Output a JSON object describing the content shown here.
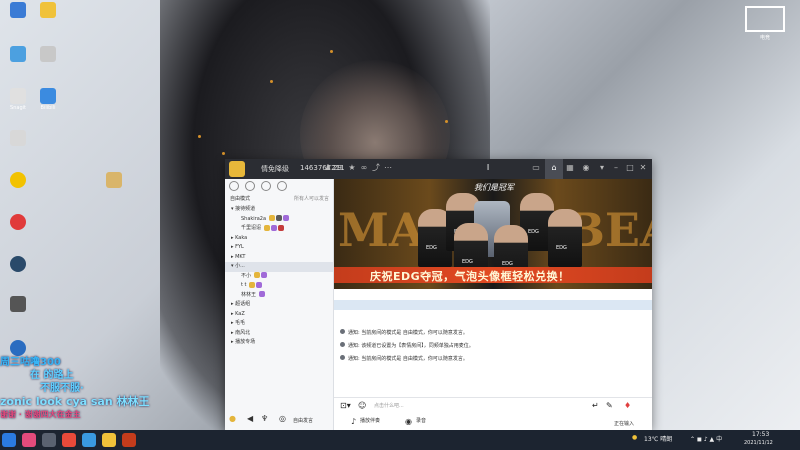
{
  "desktop": {
    "icons": [
      "Snagit",
      "Snagit",
      "Bilibili",
      "",
      "",
      "",
      "",
      "",
      "",
      "",
      "",
      "",
      ""
    ],
    "stream_overlay_lines": [
      {
        "text": "周三咕噜300",
        "color": "#38b4f5"
      },
      {
        "text": "在 的路上",
        "color": "#5fd0ff"
      },
      {
        "text": "不服不服·",
        "color": "#5fd0ff"
      },
      {
        "text": "zonic look cya san 林林王",
        "color": "#7fe0ff"
      },
      {
        "text": "谢谢 · 谢谢四大在金主",
        "color": "#e34b7c"
      }
    ],
    "watermark": "电竞"
  },
  "app": {
    "title": {
      "channel_name": "情免降级",
      "channel_id": "1463767211",
      "online_count": "29"
    },
    "top_icons": [
      "home-icon",
      "grid-icon",
      "gamepad-icon",
      "shirt-icon",
      "minimize-icon",
      "maximize-icon",
      "close-icon"
    ],
    "left_panel": {
      "mode_label": "自由模式",
      "mode_right": "所有人可以发言",
      "channels": [
        {
          "name": "接待频道",
          "type": "group",
          "expanded": true
        },
        {
          "name": "Shakira2a",
          "type": "user"
        },
        {
          "name": "千里迢迢",
          "type": "user"
        },
        {
          "name": "Kaka",
          "type": "group"
        },
        {
          "name": "FYL",
          "type": "group"
        },
        {
          "name": "MKT",
          "type": "group"
        },
        {
          "name": "小...",
          "type": "group",
          "active": true
        },
        {
          "name": "不小",
          "type": "user"
        },
        {
          "name": "t t",
          "type": "user"
        },
        {
          "name": "林林王",
          "type": "user"
        },
        {
          "name": "超话组",
          "type": "group"
        },
        {
          "name": "KaZ",
          "type": "group"
        },
        {
          "name": "毛毛",
          "type": "group"
        },
        {
          "name": "南风北",
          "type": "group"
        },
        {
          "name": "播放专场",
          "type": "group"
        }
      ]
    },
    "banner": {
      "top_text": "我们是冠军",
      "left_big": "MAK",
      "right_big": "BEAK",
      "strip_text": "庆祝EDG夺冠，气泡头像框轻松兑换！",
      "team": "EDG"
    },
    "messages": [
      "通知: 当前房间的模式是 自由模式，你可以随意发言。",
      "通知: 该频道已设置为【表情房间】，同频单独占用麦位。",
      "通知: 当前房间的模式是 自由模式，你可以随意发言。"
    ],
    "input_placeholder": "点击什么吧...",
    "input_right": "正在输入",
    "bottom_bar": {
      "mic_label": "自由发言",
      "music_label": "播放伴奏",
      "record_label": "录音"
    }
  },
  "taskbar": {
    "weather": "13℃ 晴朗",
    "time": "17:53",
    "date": "2021/11/12"
  }
}
